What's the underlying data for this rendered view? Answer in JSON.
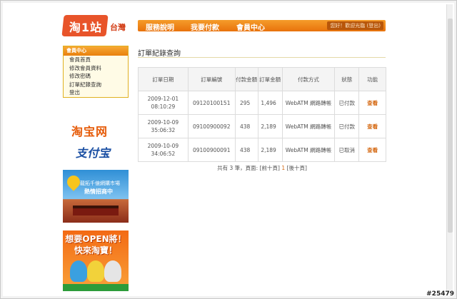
{
  "logo": {
    "main": "淘1站",
    "region": "台灣"
  },
  "nav": {
    "items": [
      "服務說明",
      "我要付款",
      "會員中心"
    ],
    "user": "您好！歡迎光臨 (登出)"
  },
  "sidebar": {
    "heading": "會員中心",
    "items": [
      "會員首頁",
      "修改會員資料",
      "修改密碼",
      "訂單紀錄查詢",
      "登出"
    ]
  },
  "banners": {
    "taobao": "淘宝网",
    "alipay": "支付宝",
    "ad1": {
      "line1": "龍拓千億網購市場",
      "line2": "熱情招商中"
    },
    "ad2": {
      "line1": "想要OPEN將！",
      "line2": "快來淘寶！"
    }
  },
  "main": {
    "title": "訂單紀錄查詢",
    "columns": [
      "訂單日期",
      "訂單編號",
      "付款金額",
      "訂單金額",
      "付款方式",
      "狀態",
      "功能"
    ],
    "rows": [
      {
        "date": "2009-12-01",
        "time": "08:10:29",
        "id": "09120100151",
        "paid": "295",
        "total": "1,496",
        "method": "WebATM 網路轉帳",
        "status": "已付款",
        "action": "查看"
      },
      {
        "date": "2009-10-09",
        "time": "35:06:32",
        "id": "09100900092",
        "paid": "438",
        "total": "2,189",
        "method": "WebATM 網路轉帳",
        "status": "已付款",
        "action": "查看"
      },
      {
        "date": "2009-10-09",
        "time": "34:06:52",
        "id": "09100900091",
        "paid": "438",
        "total": "2,189",
        "method": "WebATM 網路轉帳",
        "status": "已取消",
        "action": "查看"
      }
    ],
    "pager": {
      "prefix": "共有 3 筆，頁面:",
      "prev": "[前十頁]",
      "current": "1",
      "next": "[後十頁]"
    }
  },
  "watermark": "#25479",
  "colors": {
    "accent": "#e8720c",
    "link": "#d4660e"
  }
}
